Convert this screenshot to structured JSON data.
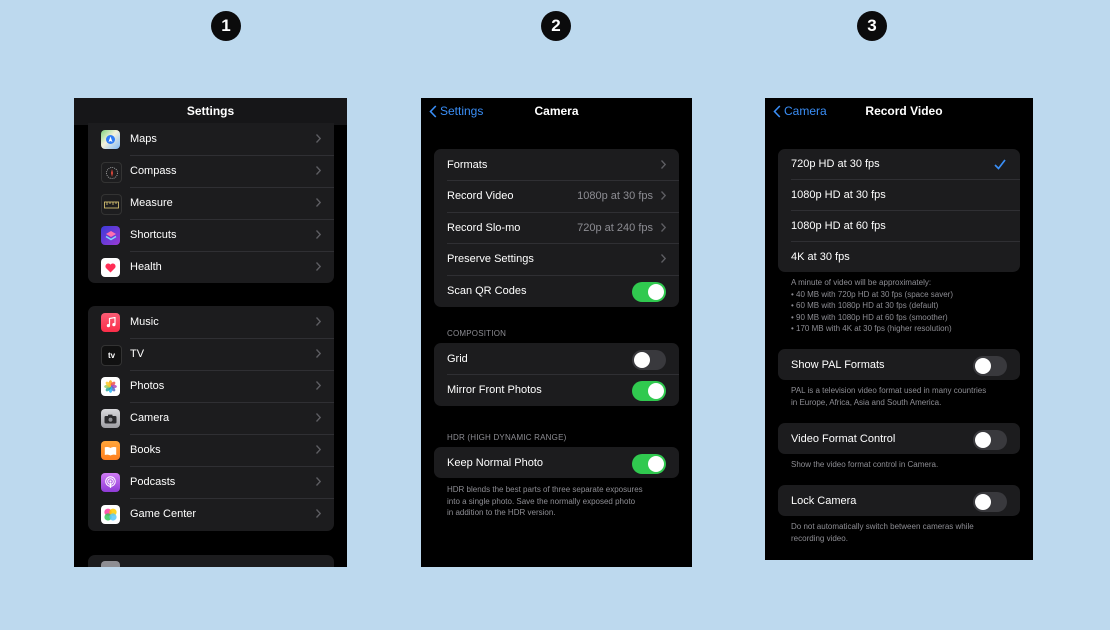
{
  "steps": [
    "1",
    "2",
    "3"
  ],
  "settings": {
    "title": "Settings",
    "group1": [
      {
        "icon": "maps-icon",
        "label": "Maps"
      },
      {
        "icon": "compass-icon",
        "label": "Compass"
      },
      {
        "icon": "measure-icon",
        "label": "Measure"
      },
      {
        "icon": "shortcuts-icon",
        "label": "Shortcuts"
      },
      {
        "icon": "health-icon",
        "label": "Health"
      }
    ],
    "group2": [
      {
        "icon": "music-icon",
        "label": "Music"
      },
      {
        "icon": "tv-icon",
        "label": "TV",
        "glyph": "tv"
      },
      {
        "icon": "photos-icon",
        "label": "Photos"
      },
      {
        "icon": "camera-icon",
        "label": "Camera"
      },
      {
        "icon": "books-icon",
        "label": "Books"
      },
      {
        "icon": "podcasts-icon",
        "label": "Podcasts"
      },
      {
        "icon": "game-center-icon",
        "label": "Game Center"
      }
    ]
  },
  "camera": {
    "back": "Settings",
    "title": "Camera",
    "rows": [
      {
        "label": "Formats"
      },
      {
        "label": "Record Video",
        "value": "1080p at 30 fps"
      },
      {
        "label": "Record Slo-mo",
        "value": "720p at 240 fps"
      },
      {
        "label": "Preserve Settings"
      },
      {
        "label": "Scan QR Codes",
        "toggle": true
      }
    ],
    "composition_header": "COMPOSITION",
    "composition": [
      {
        "label": "Grid",
        "toggle": false
      },
      {
        "label": "Mirror Front Photos",
        "toggle": true
      }
    ],
    "hdr_header": "HDR (HIGH DYNAMIC RANGE)",
    "hdr": [
      {
        "label": "Keep Normal Photo",
        "toggle": true
      }
    ],
    "hdr_footer": [
      "HDR blends the best parts of three separate exposures",
      "into a single photo. Save the normally exposed photo",
      "in addition to the HDR version."
    ]
  },
  "record": {
    "back": "Camera",
    "title": "Record Video",
    "options": [
      {
        "label": "720p HD at 30 fps",
        "selected": true
      },
      {
        "label": "1080p HD at 30 fps"
      },
      {
        "label": "1080p HD at 60 fps"
      },
      {
        "label": "4K at 30 fps"
      }
    ],
    "options_footer": [
      "A minute of video will be approximately:",
      "• 40 MB with 720p HD at 30 fps (space saver)",
      "• 60 MB with 1080p HD at 30 fps (default)",
      "• 90 MB with 1080p HD at 60 fps (smoother)",
      "• 170 MB with 4K at 30 fps (higher resolution)"
    ],
    "pal_label": "Show PAL Formats",
    "pal_footer": [
      "PAL is a television video format used in many countries",
      "in Europe, Africa, Asia and South America."
    ],
    "vfc_label": "Video Format Control",
    "vfc_footer": [
      "Show the video format control in Camera."
    ],
    "lock_label": "Lock Camera",
    "lock_footer": [
      "Do not automatically switch between cameras while",
      "recording video."
    ]
  },
  "colors": {
    "background": "#bdd9ee",
    "accent": "#3a8ef6",
    "toggle_on": "#30c94f",
    "cell": "#1c1c1e"
  }
}
